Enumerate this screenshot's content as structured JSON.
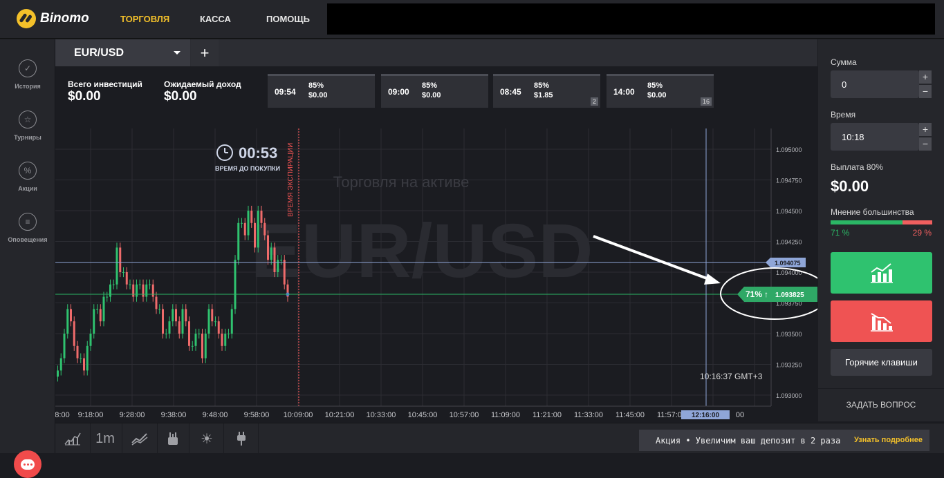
{
  "app": {
    "logo_text": "Binomo"
  },
  "nav": {
    "items": [
      "ТОРГОВЛЯ",
      "КАССА",
      "ПОМОЩЬ"
    ]
  },
  "sidebar": {
    "items": [
      {
        "label": "История",
        "icon": "check-circle-icon"
      },
      {
        "label": "Турниры",
        "icon": "trophy-icon"
      },
      {
        "label": "Акции",
        "icon": "percent-icon"
      },
      {
        "label": "Оповещения",
        "icon": "bell-list-icon"
      }
    ]
  },
  "tabs": {
    "asset": "EUR/USD",
    "add": "+"
  },
  "stats": {
    "invest_label": "Всего инвестиций",
    "invest_value": "$0.00",
    "income_label": "Ожидаемый доход",
    "income_value": "$0.00"
  },
  "deals": [
    {
      "time": "09:54",
      "pct": "85%",
      "amount": "$0.00",
      "badge": ""
    },
    {
      "time": "09:00",
      "pct": "85%",
      "amount": "$0.00",
      "badge": ""
    },
    {
      "time": "08:45",
      "pct": "85%",
      "amount": "$1.85",
      "badge": "2"
    },
    {
      "time": "14:00",
      "pct": "85%",
      "amount": "$0.00",
      "badge": "16"
    }
  ],
  "chart": {
    "timer": "00:53",
    "timer_label": "ВРЕМЯ ДО ПОКУПКИ",
    "expiry_label": "ВРЕМЯ ЭКСПИРАЦИИ",
    "watermark_sub": "Торговля на активе",
    "watermark_main": "EUR/USD",
    "current_price": "1.093825",
    "line_price": "1.094075",
    "majority_tag": "71%",
    "clock": "10:16:37 GMT+3",
    "now_time": "12:16:00"
  },
  "chart_data": {
    "type": "candlestick",
    "y_ticks": [
      "1.095000",
      "1.094750",
      "1.094500",
      "1.094250",
      "1.094000",
      "1.093750",
      "1.093500",
      "1.093250",
      "1.093000"
    ],
    "ylim": [
      1.093,
      1.095
    ],
    "x_ticks": [
      "8:00",
      "9:18:00",
      "9:28:00",
      "9:38:00",
      "9:48:00",
      "9:58:00",
      "10:09:00",
      "10:21:00",
      "10:33:00",
      "10:45:00",
      "10:57:00",
      "11:09:00",
      "11:21:00",
      "11:33:00",
      "11:45:00",
      "11:57:00",
      "12:0",
      "12:16:00",
      "00"
    ],
    "candles_close": [
      1.0932,
      1.0933,
      1.0935,
      1.0937,
      1.0936,
      1.0934,
      1.0933,
      1.0933,
      1.0932,
      1.0934,
      1.0935,
      1.0937,
      1.0937,
      1.0936,
      1.0938,
      1.0938,
      1.0939,
      1.0939,
      1.0942,
      1.094,
      1.094,
      1.0939,
      1.0939,
      1.0938,
      1.0939,
      1.0939,
      1.0938,
      1.0939,
      1.0939,
      1.0938,
      1.0937,
      1.0937,
      1.0935,
      1.0935,
      1.0936,
      1.0937,
      1.0936,
      1.0935,
      1.0937,
      1.0936,
      1.0934,
      1.0934,
      1.0935,
      1.0935,
      1.0933,
      1.0935,
      1.0937,
      1.0936,
      1.0936,
      1.0935,
      1.0934,
      1.0935,
      1.0935,
      1.0937,
      1.0941,
      1.0944,
      1.0944,
      1.0943,
      1.0945,
      1.0944,
      1.0942,
      1.0945,
      1.0944,
      1.0943,
      1.0941,
      1.0942,
      1.094,
      1.0941,
      1.0941,
      1.0939,
      1.0938
    ]
  },
  "right_panel": {
    "sum_label": "Сумма",
    "sum_value": "0",
    "time_label": "Время",
    "time_value": "10:18",
    "payout_label": "Выплата 80%",
    "payout_value": "$0.00",
    "majority_label": "Мнение большинства",
    "majority_up": "71 %",
    "majority_down": "29 %",
    "majority_up_fraction": 0.71,
    "hotkeys": "Горячие клавиши",
    "ask": "ЗАДАТЬ ВОПРОС",
    "plus": "+",
    "minus": "−"
  },
  "bottom": {
    "interval": "1m",
    "promo_text": "Акция • Увеличим ваш депозит в 2 раза",
    "promo_link": "Узнать подробнее"
  },
  "colors": {
    "accent": "#f3c02a",
    "up": "#2fc26f",
    "down": "#ef5353",
    "panel": "#25262b"
  }
}
